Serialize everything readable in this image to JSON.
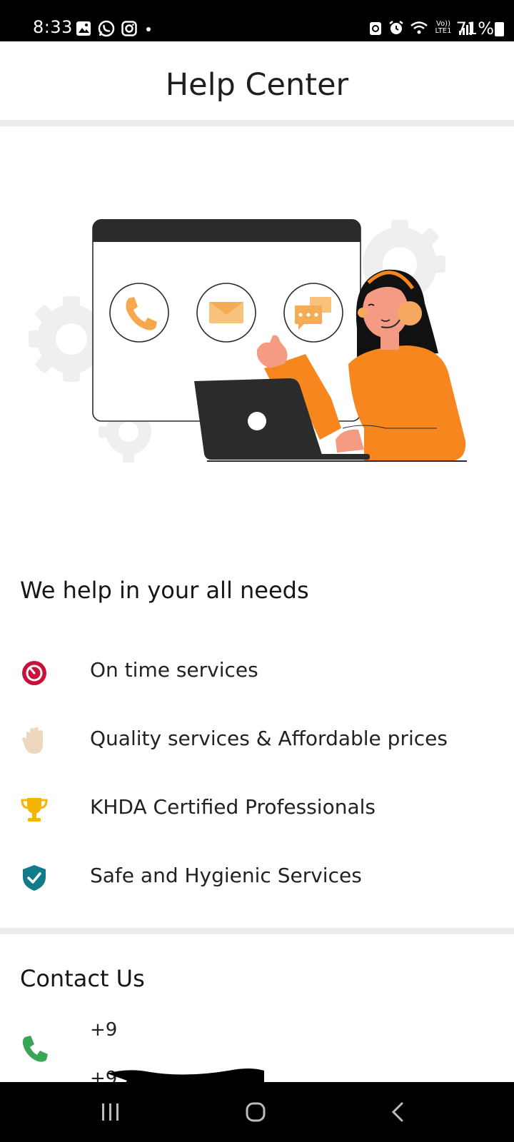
{
  "status_bar": {
    "time": "8:33",
    "battery_percent": "71%",
    "network_label": "Vo)) LTE1",
    "left_icons": [
      "gallery-icon",
      "whatsapp-icon",
      "instagram-icon",
      "dot-icon"
    ],
    "right_icons": [
      "sync-icon",
      "alarm-icon",
      "wifi-icon",
      "signal-icon",
      "battery-icon"
    ]
  },
  "header": {
    "title": "Help Center"
  },
  "hero": {
    "illustration": "support-agent-illustration",
    "contact_channels": [
      "phone-icon",
      "mail-icon",
      "chat-icon"
    ]
  },
  "features": {
    "title": "We help in your all needs",
    "items": [
      {
        "label": "On time services",
        "icon": "stopwatch-icon",
        "color": "#c8103a"
      },
      {
        "label": "Quality services & Affordable prices",
        "icon": "hand-icon",
        "color": "#eed7bf"
      },
      {
        "label": "KHDA Certified Professionals",
        "icon": "trophy-icon",
        "color": "#f4b400"
      },
      {
        "label": "Safe and Hygienic Services",
        "icon": "shield-check-icon",
        "color": "#127b8a"
      }
    ]
  },
  "contact": {
    "title": "Contact Us",
    "phones": [
      "+9",
      "+9"
    ],
    "icon": "phone-icon",
    "icon_color": "#3aa655"
  },
  "nav_bar": {
    "buttons": [
      "recents-button",
      "home-button",
      "back-button"
    ]
  }
}
